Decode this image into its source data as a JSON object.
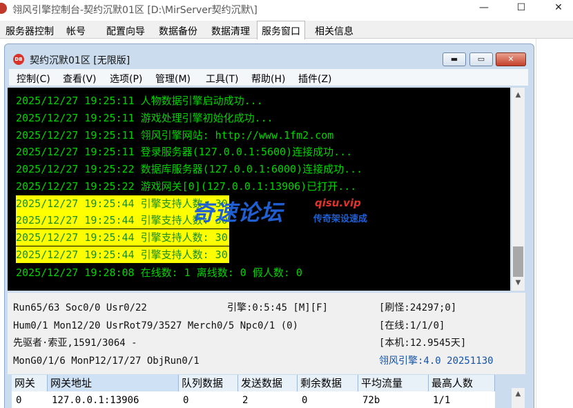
{
  "window": {
    "title": "翎风引擎控制台-契约沉默01区 [D:\\MirServer契约沉默\\]",
    "min_glyph": "—",
    "max_glyph": "☐",
    "close_glyph": "✕"
  },
  "tabs": [
    {
      "label": "服务器控制",
      "active": false
    },
    {
      "label": "帐号",
      "active": false
    },
    {
      "label": "配置向导",
      "active": false
    },
    {
      "label": "数据备份",
      "active": false
    },
    {
      "label": "数据清理",
      "active": false
    },
    {
      "label": "服务窗口",
      "active": true
    },
    {
      "label": "相关信息",
      "active": false
    }
  ],
  "child_window": {
    "title": "契约沉默01区 [无限版]",
    "icon_text": "DB",
    "min_glyph": "▬",
    "max_glyph": "▭",
    "close_glyph": "✕"
  },
  "menu": [
    "控制(C)",
    "查看(V)",
    "选项(P)",
    "管理(M)",
    "工具(T)",
    "帮助(H)",
    "插件(Z)"
  ],
  "log_lines": [
    {
      "text": "2025/12/27 19:25:11 人物数据引擎启动成功...",
      "highlight": false
    },
    {
      "text": "2025/12/27 19:25:11 游戏处理引擎初始化成功...",
      "highlight": false
    },
    {
      "text": "2025/12/27 19:25:11 翎风引擎网站: http://www.1fm2.com",
      "highlight": false
    },
    {
      "text": "2025/12/27 19:25:11 登录服务器(127.0.0.1:5600)连接成功...",
      "highlight": false
    },
    {
      "text": "2025/12/27 19:25:22 数据库服务器(127.0.0.1:6000)连接成功...",
      "highlight": false
    },
    {
      "text": "2025/12/27 19:25:22 游戏网关[0](127.0.0.1:13906)已打开...",
      "highlight": false
    },
    {
      "text": "2025/12/27 19:25:44 引擎支持人数: 30",
      "highlight": true
    },
    {
      "text": "2025/12/27 19:25:44 引擎支持人数: 30",
      "highlight": true
    },
    {
      "text": "2025/12/27 19:25:44 引擎支持人数: 30",
      "highlight": true
    },
    {
      "text": "2025/12/27 19:25:44 引擎支持人数: 30",
      "highlight": true
    },
    {
      "text": "2025/12/27 19:28:08 在线数: 1 离线数: 0 假人数: 0",
      "highlight": false
    }
  ],
  "scrollbar": {
    "up": "▲",
    "down": "▼"
  },
  "status": {
    "row1_left": "Run65/63 Soc0/0 Usr0/22",
    "row1_mid": "引擎:0:5:45 [M][F]",
    "row1_right": "[刷怪:24297;0]",
    "row2_left": "Hum0/1 Mon12/20 UsrRot79/3527 Merch0/5 Npc0/1 (0)",
    "row2_right": "[在线:1/1/0]",
    "row3_left": "先驱者·索亚,1591/3064 -",
    "row3_right": "[本机:12.9545天]",
    "row4_left": "MonG0/1/6 MonP12/17/27 ObjRun0/1",
    "row4_right": "翎风引擎:4.0 20251130"
  },
  "table": {
    "headers": [
      "网关",
      "网关地址",
      "队列数据",
      "发送数据",
      "剩余数据",
      "平均流量",
      "最高人数"
    ],
    "rows": [
      [
        "0",
        "127.0.0.1:13906",
        "0",
        "2",
        "0",
        "72b",
        "1/1"
      ]
    ]
  },
  "watermark": {
    "main": "奇速论坛",
    "site": "qisu.vip",
    "sub": "传奇架设速成"
  },
  "colors": {
    "console_bg": "#000000",
    "console_text": "#00d400",
    "highlight_bg": "#ffff00",
    "version_text": "#1453a8"
  }
}
